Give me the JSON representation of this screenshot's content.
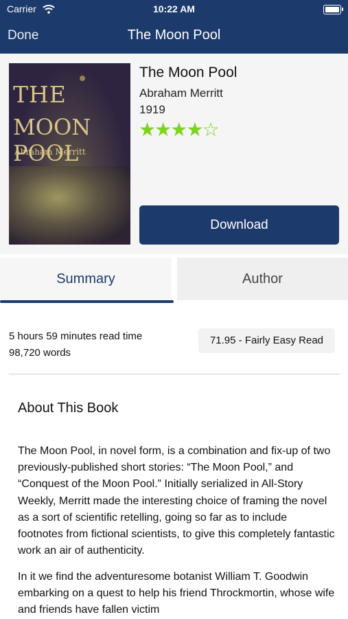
{
  "status_bar": {
    "carrier": "Carrier",
    "time": "10:22 AM",
    "wifi_icon": "wifi-icon",
    "battery_icon": "battery-icon"
  },
  "nav": {
    "done_label": "Done",
    "title": "The Moon Pool"
  },
  "book": {
    "cover_lines": [
      "THE",
      "MOON POOL",
      "Abraham Merritt"
    ],
    "title": "The Moon Pool",
    "author": "Abraham Merritt",
    "year": "1919",
    "rating": {
      "filled": 4,
      "total": 5,
      "star_color": "#7ed321"
    },
    "download_label": "Download"
  },
  "tabs": {
    "summary_label": "Summary",
    "author_label": "Author",
    "active": "summary"
  },
  "stats": {
    "read_time": "5 hours 59 minutes read time",
    "word_count": "98,720 words",
    "reading_ease": "71.95 - Fairly Easy Read"
  },
  "about": {
    "heading": "About This Book",
    "paragraph_1": "The Moon Pool, in novel form, is a combination and fix-up of two previously-published short stories: “The Moon Pool,” and “Conquest of the Moon Pool.” Initially serialized in All-Story Weekly, Merritt made the interesting choice of framing the novel as a sort of scientific retelling, going so far as to include footnotes from fictional scientists, to give this completely fantastic work an air of authenticity.",
    "paragraph_2": "In it we find the adventuresome botanist William T. Goodwin embarking on a quest to help his friend Throckmortin, whose wife and friends have fallen victim"
  },
  "colors": {
    "accent": "#1c3a6b",
    "book_panel": "#f5f5f6"
  }
}
